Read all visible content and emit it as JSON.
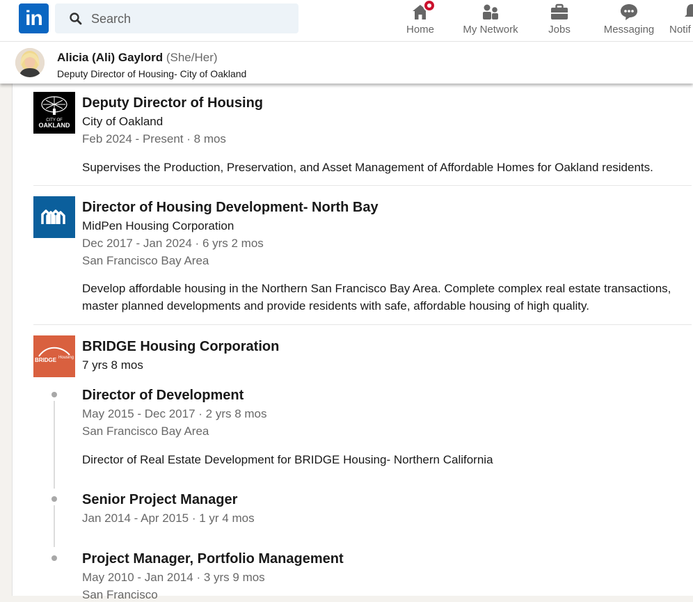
{
  "nav": {
    "logo_text": "in",
    "search_placeholder": "Search",
    "items": [
      {
        "label": "Home",
        "icon": "home-icon"
      },
      {
        "label": "My Network",
        "icon": "network-icon"
      },
      {
        "label": "Jobs",
        "icon": "briefcase-icon"
      },
      {
        "label": "Messaging",
        "icon": "messaging-icon"
      },
      {
        "label": "Notif",
        "icon": "bell-icon"
      }
    ]
  },
  "profile": {
    "name": "Alicia (Ali) Gaylord",
    "pronouns": "(She/Her)",
    "headline": "Deputy Director of Housing- City of Oakland"
  },
  "experience": {
    "oakland": {
      "logo_text_top": "CITY OF",
      "logo_text_bottom": "OAKLAND",
      "title": "Deputy Director of Housing",
      "company": "City of Oakland",
      "dates": "Feb 2024 - Present · 8 mos",
      "description": "Supervises the Production, Preservation, and Asset Management of Affordable Homes for Oakland residents."
    },
    "midpen": {
      "title": "Director of Housing Development- North Bay",
      "company": "MidPen Housing Corporation",
      "dates": "Dec 2017 - Jan 2024 · 6 yrs 2 mos",
      "location": "San Francisco Bay Area",
      "description": "Develop affordable housing in the Northern San Francisco Bay Area. Complete complex real estate transactions, master planned developments and provide residents with safe, affordable housing of high quality."
    },
    "bridge": {
      "logo_text": "BRIDGE",
      "logo_text_small": "Housing",
      "company": "BRIDGE Housing Corporation",
      "duration": "7 yrs 8 mos",
      "roles": [
        {
          "title": "Director of Development",
          "dates": "May 2015 - Dec 2017 · 2 yrs 8 mos",
          "location": "San Francisco Bay Area",
          "description": "Director of Real Estate Development for BRIDGE Housing- Northern California"
        },
        {
          "title": "Senior Project Manager",
          "dates": "Jan 2014 - Apr 2015 · 1 yr 4 mos"
        },
        {
          "title": "Project Manager, Portfolio Management",
          "dates": "May 2010 - Jan 2014 · 3 yrs 9 mos",
          "location": "San Francisco"
        }
      ]
    }
  },
  "colors": {
    "brand": "#0a66c2",
    "notification": "#cb112d",
    "midpen": "#0b5f9c",
    "bridge": "#d9603f"
  }
}
